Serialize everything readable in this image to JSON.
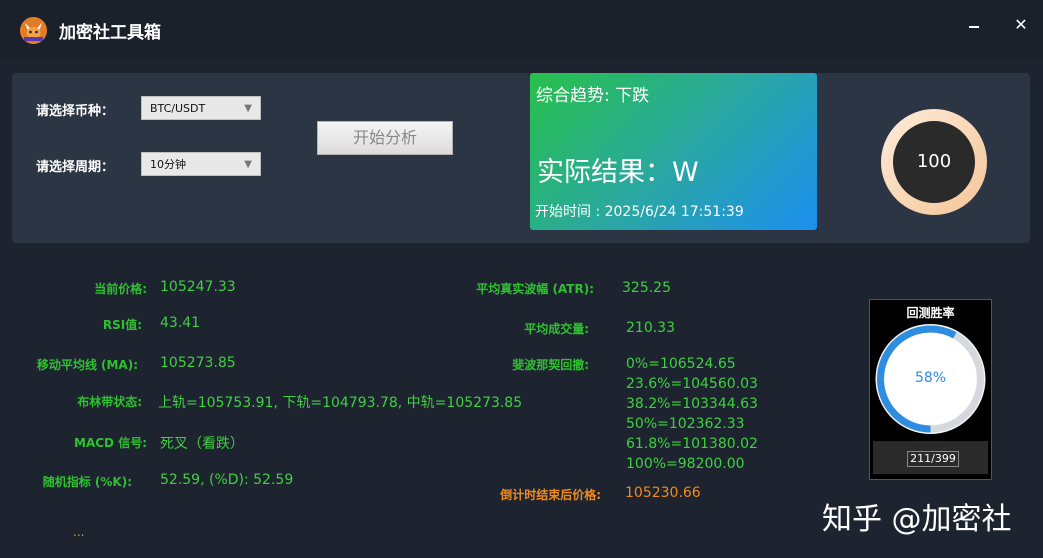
{
  "window": {
    "title": "加密社工具箱",
    "minimize_glyph": "",
    "close_glyph": "✕"
  },
  "form": {
    "coin_label": "请选择币种：",
    "coin_value": "BTC/USDT",
    "period_label": "请选择周期：",
    "period_value": "10分钟",
    "start_button": "开始分析"
  },
  "result_card": {
    "trend": "综合趋势: 下跌",
    "result": "实际结果：W",
    "start_time": "开始时间 : 2025/6/24 17:51:39"
  },
  "ring": {
    "value": "100",
    "fill_fraction": 1.0
  },
  "metrics_left": [
    {
      "label": "当前价格:",
      "value": "105247.33"
    },
    {
      "label": "RSI值:",
      "value": "43.41"
    },
    {
      "label": "移动平均线 (MA):",
      "value": "105273.85"
    },
    {
      "label": "布林带状态:",
      "value": "上轨=105753.91, 下轨=104793.78, 中轨=105273.85"
    },
    {
      "label": "MACD 信号:",
      "value": "死叉（看跌）"
    },
    {
      "label": "随机指标 (%K):",
      "value": "52.59, (%D): 52.59"
    }
  ],
  "metrics_right": {
    "atr_label": "平均真实波幅 (ATR):",
    "atr_value": "325.25",
    "volume_label": "平均成交量:",
    "volume_value": "210.33",
    "fib_label": "斐波那契回撤:",
    "fib_values": [
      "0%=106524.65",
      "23.6%=104560.03",
      "38.2%=103344.63",
      "50%=102362.33",
      "61.8%=101380.02",
      "100%=98200.00"
    ],
    "end_price_label": "倒计时结束后价格:",
    "end_price_value": "105230.66"
  },
  "winrate": {
    "title": "回测胜率",
    "percent": "58%",
    "fraction": 0.58,
    "count": "211/399"
  },
  "ellipsis": "...",
  "watermark": "知乎 @加密社",
  "colors": {
    "accent_green": "#3fd040",
    "label_green": "#2fc02f",
    "orange": "#f08a1e",
    "blue": "#2e8de0"
  }
}
